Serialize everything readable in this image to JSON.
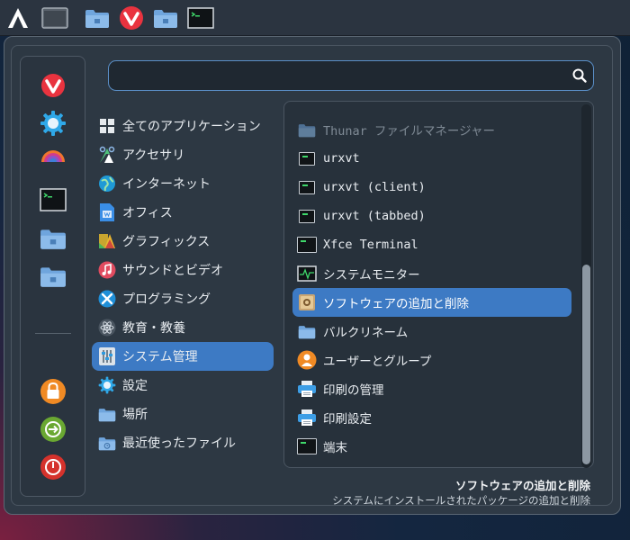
{
  "topbar": {
    "items": [
      "app-menu-icon",
      "desktop-icon",
      "folder-icon",
      "vivaldi-icon",
      "folder-icon",
      "terminal-icon"
    ]
  },
  "search": {
    "placeholder": ""
  },
  "sidebar": {
    "favorites": [
      "vivaldi-icon",
      "settings-icon",
      "color-picker-icon",
      "terminal-icon",
      "folder-icon",
      "folder-icon"
    ],
    "actions": [
      "lock-icon",
      "logout-icon",
      "power-icon"
    ]
  },
  "categories": [
    {
      "label": "全てのアプリケーション",
      "icon": "grid-icon"
    },
    {
      "label": "アクセサリ",
      "icon": "accessories-icon"
    },
    {
      "label": "インターネット",
      "icon": "globe-icon"
    },
    {
      "label": "オフィス",
      "icon": "office-icon"
    },
    {
      "label": "グラフィックス",
      "icon": "graphics-icon"
    },
    {
      "label": "サウンドとビデオ",
      "icon": "music-icon"
    },
    {
      "label": "プログラミング",
      "icon": "programming-icon"
    },
    {
      "label": "教育・教養",
      "icon": "atom-icon"
    },
    {
      "label": "システム管理",
      "icon": "system-icon",
      "selected": true
    },
    {
      "label": "設定",
      "icon": "gear-icon"
    },
    {
      "label": "場所",
      "icon": "folder-icon"
    },
    {
      "label": "最近使ったファイル",
      "icon": "recent-icon"
    }
  ],
  "apps": [
    {
      "label": "Thunar ファイルマネージャー",
      "icon": "folder-icon",
      "dim": true
    },
    {
      "label": "urxvt",
      "icon": "terminal-icon"
    },
    {
      "label": "urxvt (client)",
      "icon": "terminal-icon"
    },
    {
      "label": "urxvt (tabbed)",
      "icon": "terminal-icon"
    },
    {
      "label": "Xfce Terminal",
      "icon": "terminal-icon"
    },
    {
      "label": "システムモニター",
      "icon": "system-monitor-icon"
    },
    {
      "label": "ソフトウェアの追加と削除",
      "icon": "package-icon",
      "selected": true
    },
    {
      "label": "バルクリネーム",
      "icon": "folder-icon"
    },
    {
      "label": "ユーザーとグループ",
      "icon": "users-icon"
    },
    {
      "label": "印刷の管理",
      "icon": "printer-icon"
    },
    {
      "label": "印刷設定",
      "icon": "printer-icon"
    },
    {
      "label": "端末",
      "icon": "terminal-icon"
    }
  ],
  "description": {
    "title": "ソフトウェアの追加と削除",
    "subtitle": "システムにインストールされたパッケージの追加と削除"
  },
  "colors": {
    "accent": "#3d7ac4",
    "background": "#2f3a46"
  }
}
